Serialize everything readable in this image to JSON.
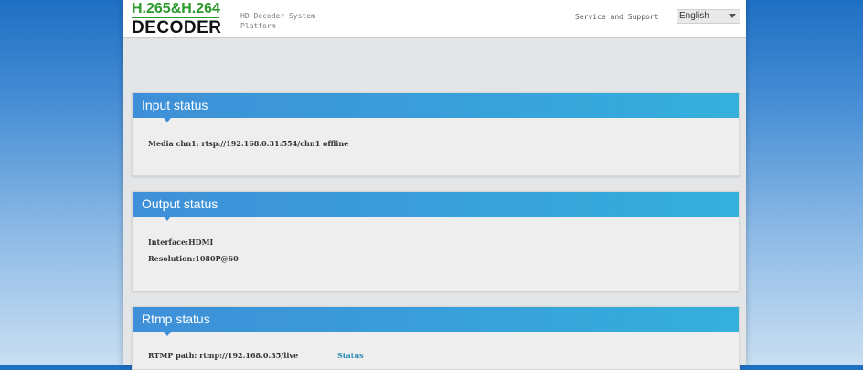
{
  "header": {
    "logo_top": "H.265&H.264",
    "logo_bottom": "DECODER",
    "platform_title": "HD Decoder System Platform",
    "support_link": "Service and Support",
    "language_selected": "English"
  },
  "input_status": {
    "title": "Input status",
    "media_line": "Media chn1: rtsp://192.168.0.31:554/chn1 offline"
  },
  "output_status": {
    "title": "Output status",
    "interface_line": "Interface:HDMI",
    "resolution_line": "Resolution:1080P@60"
  },
  "rtmp_status": {
    "title": "Rtmp status",
    "path_line": "RTMP path: rtmp://192.168.0.35/live",
    "status_link": "Status"
  },
  "colors": {
    "panel_header_start": "#3e8fd8",
    "panel_header_end": "#35b0dc",
    "logo_green": "#2a9a2a",
    "link_blue": "#2a8cb8"
  }
}
